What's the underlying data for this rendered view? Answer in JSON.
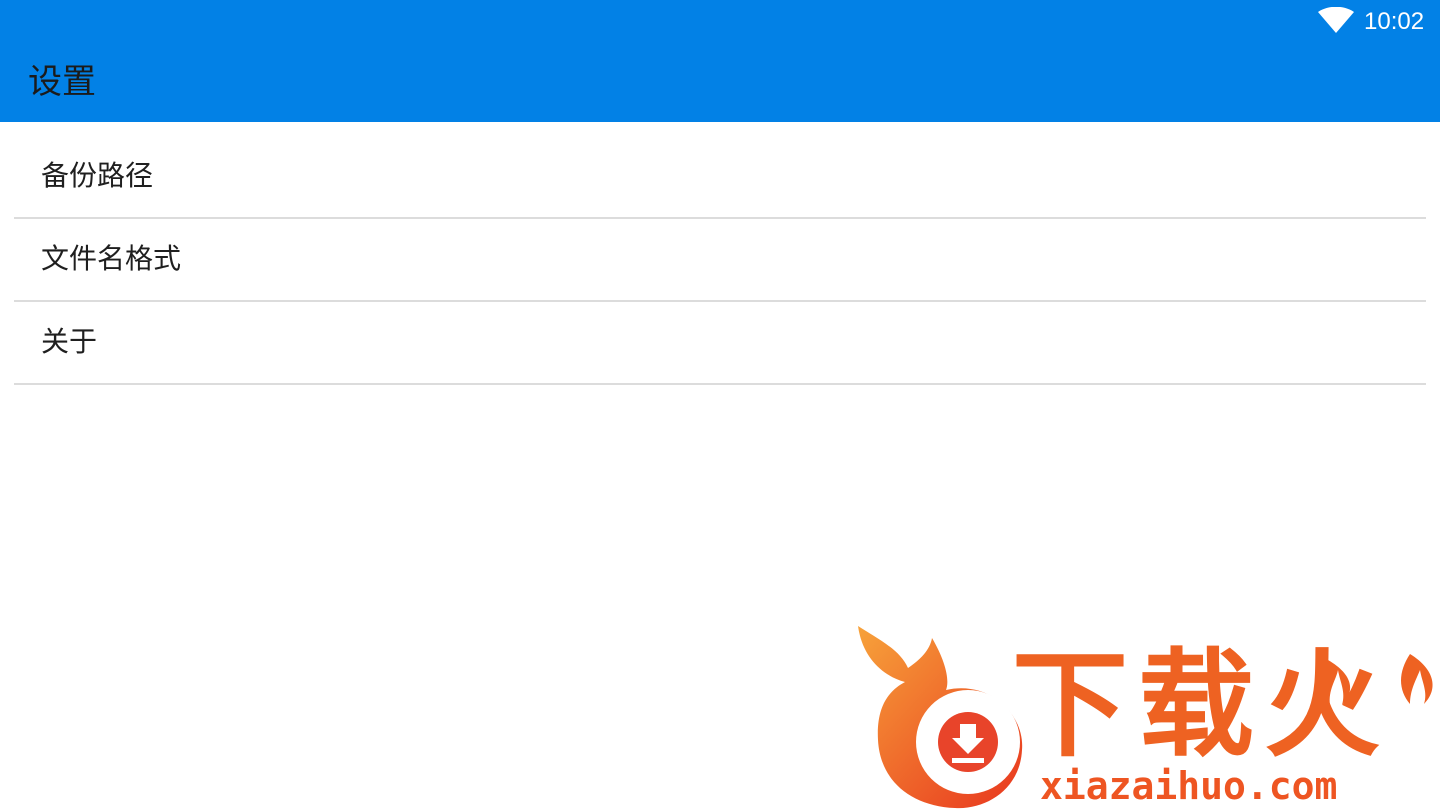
{
  "status_bar": {
    "time": "10:02",
    "wifi_icon": "wifi-icon"
  },
  "header": {
    "title": "设置",
    "background_color": "#0281e6"
  },
  "settings": {
    "items": [
      {
        "label": "备份路径"
      },
      {
        "label": "文件名格式"
      },
      {
        "label": "关于"
      }
    ]
  },
  "watermark": {
    "brand_text": "下载火",
    "url": "xiazaihuo.com",
    "logo_icon": "flame-download-logo",
    "color": "#ee6222"
  }
}
